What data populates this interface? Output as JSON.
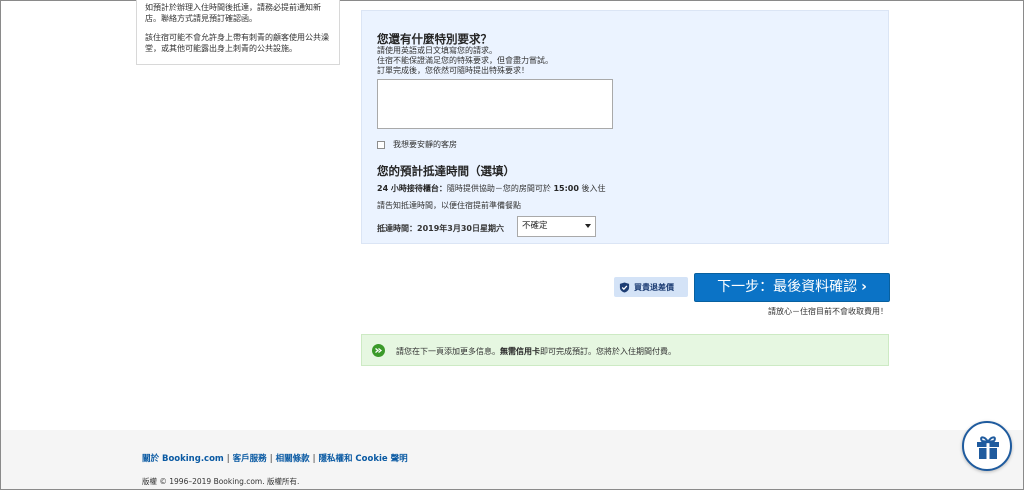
{
  "info_box": {
    "para1": "如預計於辦理入住時間後抵達，請務必提前通知新店。聯絡方式請見預訂確認函。",
    "para2": "該住宿可能不會允許身上帶有刺青的顧客使用公共澡堂，或其他可能露出身上刺青的公共設施。"
  },
  "special_request": {
    "title": "您還有什麼特別要求？",
    "line1": "請使用英語或日文填寫您的請求。",
    "line2": "住宿不能保證滿足您的特殊要求，但會盡力嘗試。",
    "line3": "訂單完成後，您依然可隨時提出特殊要求！",
    "textarea_value": "",
    "quiet_room_label": "我想要安靜的客房"
  },
  "arrival": {
    "title": "您的預計抵達時間（選填）",
    "desk_label": "24 小時接待櫃台：",
    "desk_text": "隨時提供協助－您的房間可於",
    "checkin_time": "15:00",
    "desk_suffix": "後入住",
    "notice": "請告知抵達時間，以便住宿提前準備餐點",
    "arrival_label": "抵達時間：",
    "arrival_date": "2019年3月30日星期六",
    "select_value": "不確定"
  },
  "price_badge": {
    "label": "買貴退差價"
  },
  "next_step": {
    "label": "下一步：最後資料確認",
    "chevron": "›",
    "reassure": "請放心－住宿目前不會收取費用！"
  },
  "banner": {
    "text_before": "請您在下一頁添加更多信息。",
    "text_bold": "無需信用卡",
    "text_after": "即可完成預訂。您將於入住期間付費。"
  },
  "footer": {
    "links": [
      "關於 Booking.com",
      "客戶服務",
      "相關條款",
      "隱私權和 Cookie 聲明"
    ],
    "separator": "|",
    "copyright": "版權 © 1996–2019 Booking.com. 版權所有."
  },
  "colors": {
    "primary_blue": "#0b73c6",
    "panel_bg": "#ebf3ff",
    "banner_bg": "#e6f7e1",
    "link_blue": "#0a5aa3"
  }
}
